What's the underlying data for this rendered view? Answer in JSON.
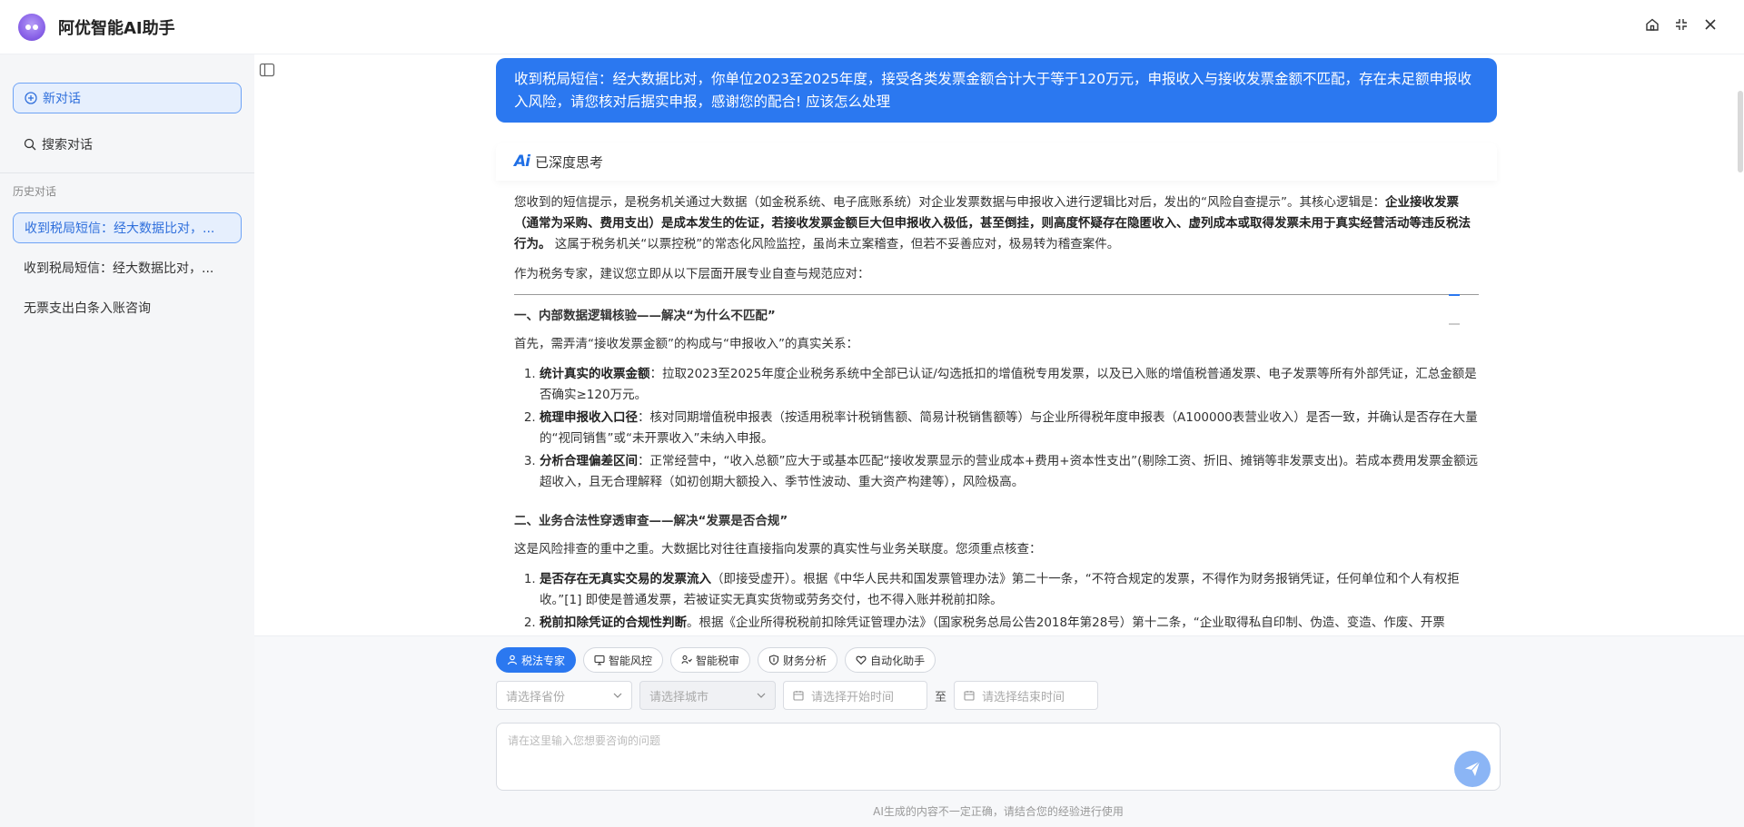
{
  "app": {
    "title": "阿优智能AI助手"
  },
  "sidebar": {
    "new_chat": "新对话",
    "search_chat": "搜索对话",
    "history_label": "历史对话",
    "history": [
      {
        "label": "收到税局短信：经大数据比对，...",
        "active": true
      },
      {
        "label": "收到税局短信：经大数据比对，...",
        "active": false
      },
      {
        "label": "无票支出白条入账咨询",
        "active": false
      }
    ]
  },
  "conversation": {
    "user_message": "收到税局短信：经大数据比对，你单位2023至2025年度，接受各类发票金额合计大于等于120万元，申报收入与接收发票金额不匹配，存在未足额申报收入风险，请您核对后据实申报，感谢您的配合! 应该怎么处理",
    "thinking_label": "已深度思考",
    "answer": {
      "intro_a": "您收到的短信提示，是税务机关通过大数据（如金税系统、电子底账系统）对企业发票数据与申报收入进行逻辑比对后，发出的“风险自查提示”。其核心逻辑是：",
      "intro_bold": "企业接收发票（通常为采购、费用支出）是成本发生的佐证，若接收发票金额巨大但申报收入极低，甚至倒挂，则高度怀疑存在隐匿收入、虚列成本或取得发票未用于真实经营活动等违反税法行为。",
      "intro_b": " 这属于税务机关“以票控税”的常态化风险监控，虽尚未立案稽查，但若不妥善应对，极易转为稽查案件。",
      "intro2": "作为税务专家，建议您立即从以下层面开展专业自查与规范应对：",
      "section1_title": "一、内部数据逻辑核验——解决“为什么不匹配”",
      "section1_intro": "首先，需弄清“接收发票金额”的构成与“申报收入”的真实关系：",
      "section1_items": [
        {
          "bold": "统计真实的收票金额",
          "text": "：拉取2023至2025年度企业税务系统中全部已认证/勾选抵扣的增值税专用发票，以及已入账的增值税普通发票、电子发票等所有外部凭证，汇总金额是否确实≥120万元。"
        },
        {
          "bold": "梳理申报收入口径",
          "text": "：核对同期增值税申报表（按适用税率计税销售额、简易计税销售额等）与企业所得税年度申报表（A100000表营业收入）是否一致，并确认是否存在大量的“视同销售”或“未开票收入”未纳入申报。"
        },
        {
          "bold": "分析合理偏差区间",
          "text": "：正常经营中，“收入总额”应大于或基本匹配“接收发票显示的营业成本+费用+资本性支出”(剔除工资、折旧、摊销等非发票支出)。若成本费用发票金额远超收入，且无合理解释（如初创期大额投入、季节性波动、重大资产构建等），风险极高。"
        }
      ],
      "section2_title": "二、业务合法性穿透审查——解决“发票是否合规”",
      "section2_intro": "这是风险排查的重中之重。大数据比对往往直接指向发票的真实性与业务关联度。您须重点核查：",
      "section2_items": [
        {
          "bold": "是否存在无真实交易的发票流入",
          "text": "（即接受虚开）。根据《中华人民共和国发票管理办法》第二十一条，“不符合规定的发票，不得作为财务报销凭证，任何单位和个人有权拒收。”[1] 即使是普通发票，若被证实无真实货物或劳务交付，也不得入账并税前扣除。"
        },
        {
          "bold": "税前扣除凭证的合规性判断",
          "text": "。根据《企业所得税税前扣除凭证管理办法》（国家税务总局公告2018年第28号）第十二条，“企业取得私自印制、伪造、变造、作废、开票"
        }
      ]
    }
  },
  "composer": {
    "chips": [
      {
        "label": "税法专家",
        "icon": "expert-icon",
        "active": true
      },
      {
        "label": "智能风控",
        "icon": "monitor-icon",
        "active": false
      },
      {
        "label": "智能税审",
        "icon": "review-icon",
        "active": false
      },
      {
        "label": "财务分析",
        "icon": "shield-icon",
        "active": false
      },
      {
        "label": "自动化助手",
        "icon": "heart-icon",
        "active": false
      }
    ],
    "province_placeholder": "请选择省份",
    "city_placeholder": "请选择城市",
    "start_placeholder": "请选择开始时间",
    "to_label": "至",
    "end_placeholder": "请选择结束时间",
    "input_placeholder": "请在这里输入您想要咨询的问题",
    "disclaimer": "AI生成的内容不一定正确，请结合您的经验进行使用"
  },
  "colors": {
    "accent": "#2b78f0",
    "send_button": "#8bb5f5"
  }
}
